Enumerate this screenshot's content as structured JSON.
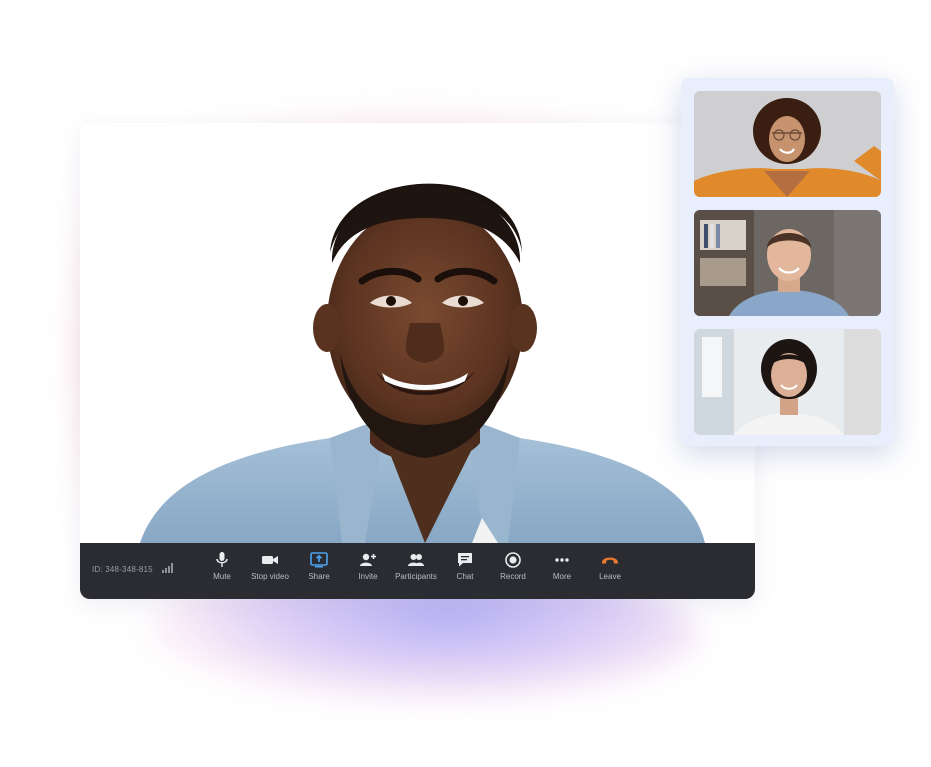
{
  "meeting": {
    "id_label": "ID: 348-348-815"
  },
  "toolbar": {
    "items": [
      {
        "label": "Mute",
        "icon": "microphone-icon"
      },
      {
        "label": "Stop video",
        "icon": "video-camera-icon"
      },
      {
        "label": "Share",
        "icon": "share-screen-icon"
      },
      {
        "label": "Invite",
        "icon": "add-person-icon"
      },
      {
        "label": "Participants",
        "icon": "participants-icon"
      },
      {
        "label": "Chat",
        "icon": "chat-icon"
      },
      {
        "label": "Record",
        "icon": "record-icon"
      },
      {
        "label": "More",
        "icon": "more-dots-icon"
      },
      {
        "label": "Leave",
        "icon": "hang-up-icon"
      }
    ]
  },
  "colors": {
    "toolbar_bg": "#2b2c31",
    "toolbar_text": "#b9bcc4",
    "share_accent": "#4aa3f0",
    "leave_accent": "#e8792f",
    "panel_bg": "#e8eefb"
  }
}
